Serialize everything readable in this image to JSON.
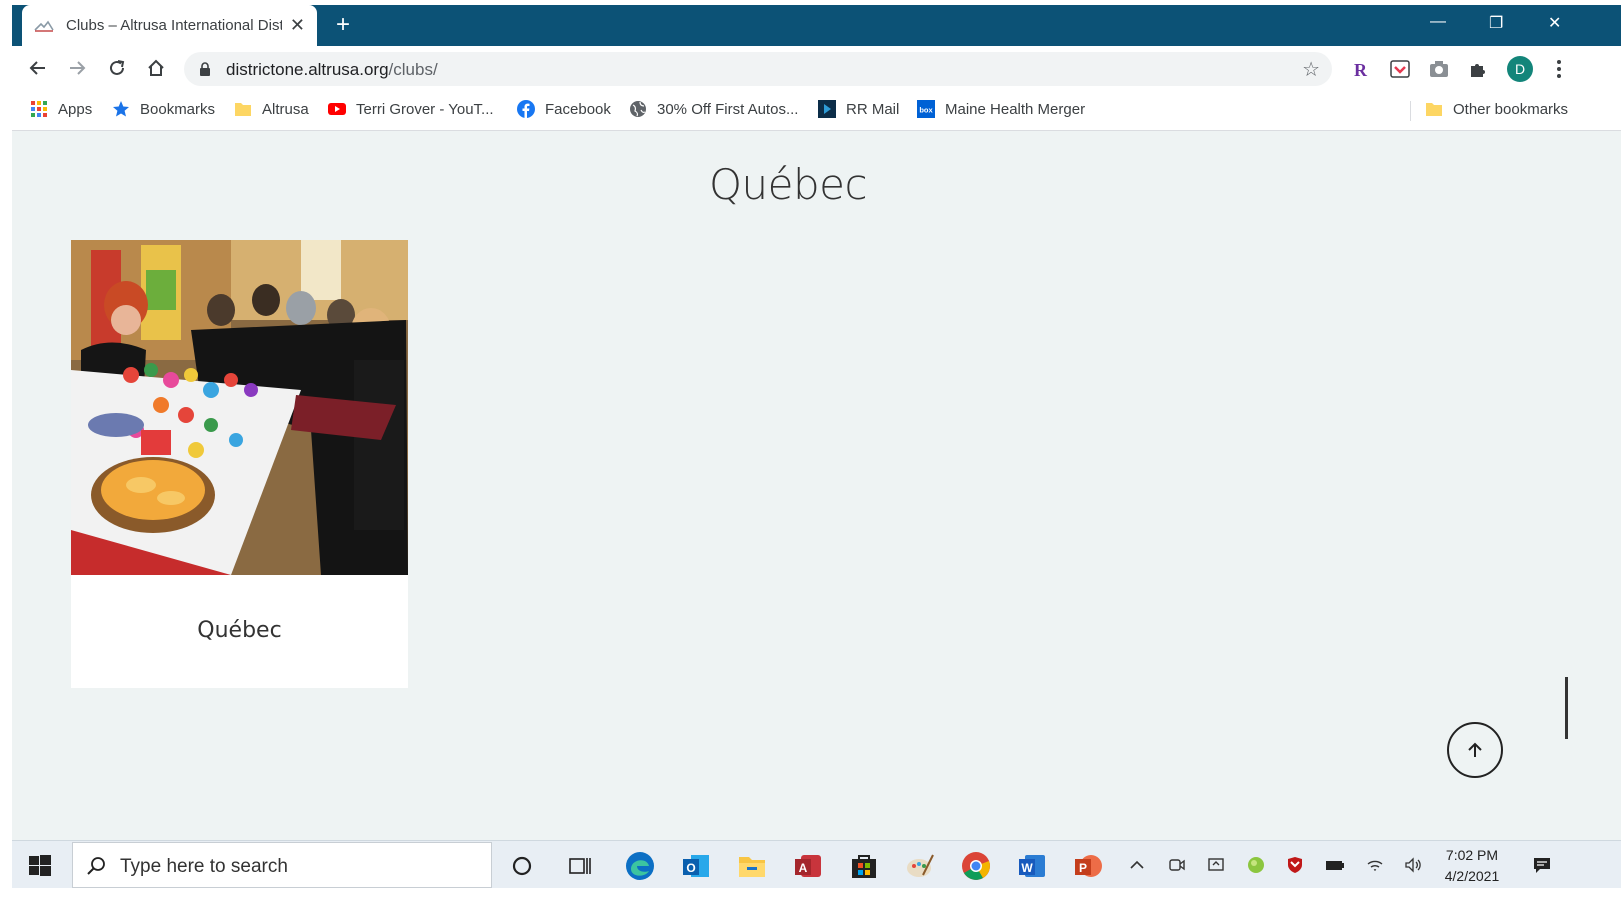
{
  "browser": {
    "tab_title": "Clubs – Altrusa International Dist",
    "url_host": "districtone.altrusa.org",
    "url_path": "/clubs/",
    "profile_initial": "D"
  },
  "bookmarks": [
    {
      "label": "Apps",
      "icon": "apps-grid-icon"
    },
    {
      "label": "Bookmarks",
      "icon": "star-icon"
    },
    {
      "label": "Altrusa",
      "icon": "folder-icon"
    },
    {
      "label": "Terri Grover - YouT...",
      "icon": "youtube-icon"
    },
    {
      "label": "Facebook",
      "icon": "facebook-icon"
    },
    {
      "label": "30% Off First Autos...",
      "icon": "globe-icon"
    },
    {
      "label": "RR Mail",
      "icon": "rr-mail-icon"
    },
    {
      "label": "Maine Health Merger",
      "icon": "box-icon"
    },
    {
      "label": "Other bookmarks",
      "icon": "folder-icon"
    }
  ],
  "page": {
    "heading": "Québec",
    "club_card": {
      "name": "Québec",
      "photo": "club-photo"
    }
  },
  "taskbar": {
    "search_placeholder": "Type here to search",
    "time": "7:02 PM",
    "date": "4/2/2021"
  },
  "colors": {
    "tab_bar": "#0c5276",
    "page_bg": "#eef3f3",
    "card_bg": "#ffffff"
  }
}
